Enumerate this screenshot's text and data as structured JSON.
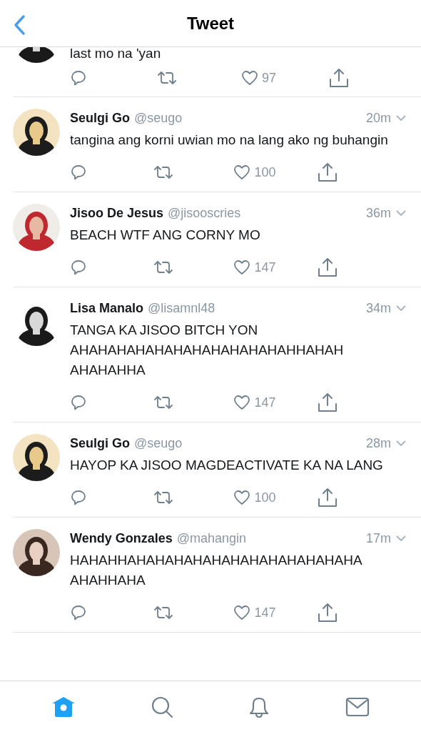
{
  "header": {
    "title": "Tweet"
  },
  "partial_tweet": {
    "text": "last mo na 'yan",
    "likes": "97"
  },
  "tweets": [
    {
      "name": "Seulgi Go",
      "handle": "@seugo",
      "time": "20m",
      "text": "tangina ang korni uwian mo na lang ako ng buhangin",
      "likes": "100"
    },
    {
      "name": "Jisoo De Jesus",
      "handle": "@jisooscries",
      "time": "36m",
      "text": "BEACH WTF ANG CORNY MO",
      "likes": "147"
    },
    {
      "name": "Lisa Manalo",
      "handle": "@lisamnl48",
      "time": "34m",
      "text": "TANGA KA JISOO BITCH YON AHAHAHAHAHAHAHAHAHAHAHAHHAHAH AHAHAHHA",
      "likes": "147"
    },
    {
      "name": "Seulgi Go",
      "handle": "@seugo",
      "time": "28m",
      "text": "HAYOP KA JISOO MAGDEACTIVATE KA NA LANG",
      "likes": "100"
    },
    {
      "name": "Wendy Gonzales",
      "handle": "@mahangin",
      "time": "17m",
      "text": "HAHAHHAHAHAHAHAHAHAHAHAHAHAHAHA AHAHHAHA",
      "likes": "147"
    }
  ],
  "tab_bar": [
    {
      "kind": "home",
      "selected": true
    },
    {
      "kind": "search",
      "selected": false
    },
    {
      "kind": "notifications",
      "selected": false
    },
    {
      "kind": "messages",
      "selected": false
    }
  ]
}
